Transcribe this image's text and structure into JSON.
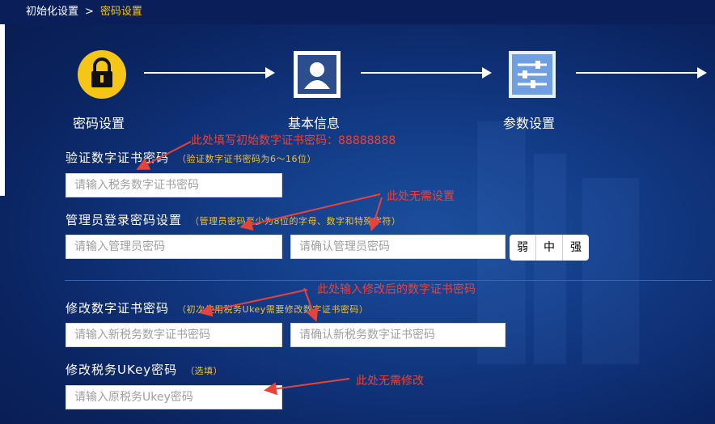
{
  "breadcrumb": {
    "root": "初始化设置",
    "separator": ">",
    "current": "密码设置"
  },
  "steps": [
    {
      "label": "密码设置",
      "icon": "lock-icon"
    },
    {
      "label": "基本信息",
      "icon": "user-profile-icon"
    },
    {
      "label": "参数设置",
      "icon": "sliders-icon"
    }
  ],
  "sections": {
    "verify": {
      "title": "验证数字证书密码",
      "hint": "（验证数字证书密码为6～16位）",
      "input_placeholder": "请输入税务数字证书密码"
    },
    "admin": {
      "title": "管理员登录密码设置",
      "hint": "（管理员密码至少为8位的字母、数字和特殊字符）",
      "password_placeholder": "请输入管理员密码",
      "confirm_placeholder": "请确认管理员密码",
      "strength": [
        "弱",
        "中",
        "强"
      ]
    },
    "modify_cert": {
      "title": "修改数字证书密码",
      "hint": "（初次使用税务Ukey需要修改数字证书密码）",
      "new_placeholder": "请输入新税务数字证书密码",
      "confirm_placeholder": "请确认新税务数字证书密码"
    },
    "modify_ukey": {
      "title": "修改税务UKey密码",
      "hint": "（选填）",
      "input_placeholder": "请输入原税务Ukey密码"
    }
  },
  "annotations": {
    "fill_cert": "此处填写初始数字证书密码：88888888",
    "no_setup": "此处无需设置",
    "enter_modified": "此处输入修改后的数字证书密码",
    "no_modify": "此处无需修改"
  },
  "colors": {
    "accent_yellow": "#f5c518",
    "annotation_red": "#e8433a",
    "background_blue": "#123a85"
  }
}
